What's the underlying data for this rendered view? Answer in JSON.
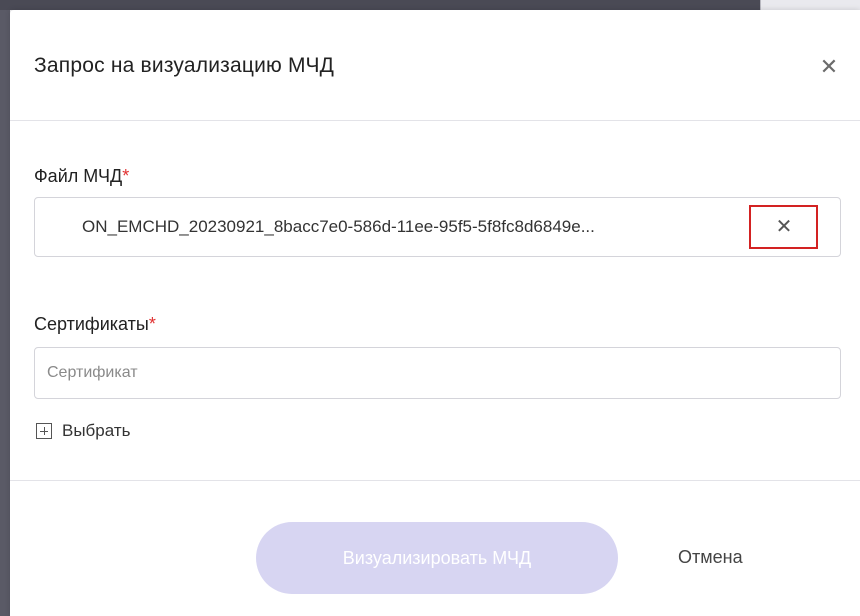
{
  "dialog": {
    "title": "Запрос на визуализацию МЧД",
    "close_icon": "close-icon"
  },
  "file_field": {
    "label": "Файл МЧД",
    "required_mark": "*",
    "file_name": "ON_EMCHD_20230921_8bacc7e0-586d-11ee-95f5-5f8fc8d6849e...",
    "clear_icon": "close-icon"
  },
  "certificates_field": {
    "label": "Сертификаты",
    "required_mark": "*",
    "placeholder": "Сертификат",
    "value": "",
    "choose_label": "Выбрать",
    "choose_icon": "plus-square-icon"
  },
  "footer": {
    "submit_label": "Визуализировать МЧД",
    "submit_enabled": false,
    "cancel_label": "Отмена"
  },
  "colors": {
    "required": "#e03030",
    "submit_disabled_bg": "#d7d5f2",
    "highlight_border": "#d32222"
  }
}
